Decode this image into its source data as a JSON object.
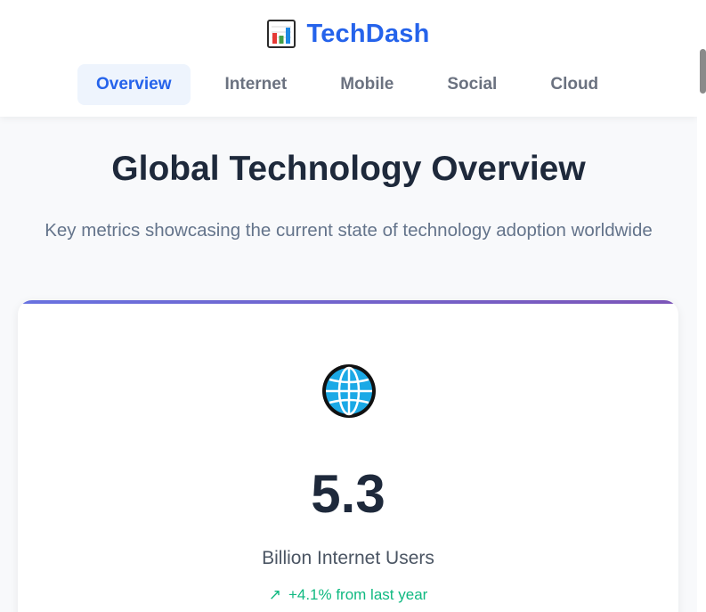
{
  "header": {
    "logo_icon": "bar-chart-icon",
    "brand_name": "TechDash",
    "brand_color": "#2563eb"
  },
  "nav": {
    "tabs": [
      {
        "label": "Overview",
        "active": true
      },
      {
        "label": "Internet",
        "active": false
      },
      {
        "label": "Mobile",
        "active": false
      },
      {
        "label": "Social",
        "active": false
      },
      {
        "label": "Cloud",
        "active": false
      }
    ]
  },
  "main": {
    "title": "Global Technology Overview",
    "subtitle": "Key metrics showcasing the current state of technology adoption worldwide",
    "cards": [
      {
        "icon": "globe-icon",
        "value": "5.3",
        "label": "Billion Internet Users",
        "trend_arrow": "↗",
        "trend_text": "+4.1% from last year",
        "trend_color": "#10b981"
      }
    ]
  },
  "colors": {
    "accent": "#2563eb",
    "card_gradient_start": "#6872e0",
    "card_gradient_end": "#7c55b8",
    "positive": "#10b981"
  }
}
